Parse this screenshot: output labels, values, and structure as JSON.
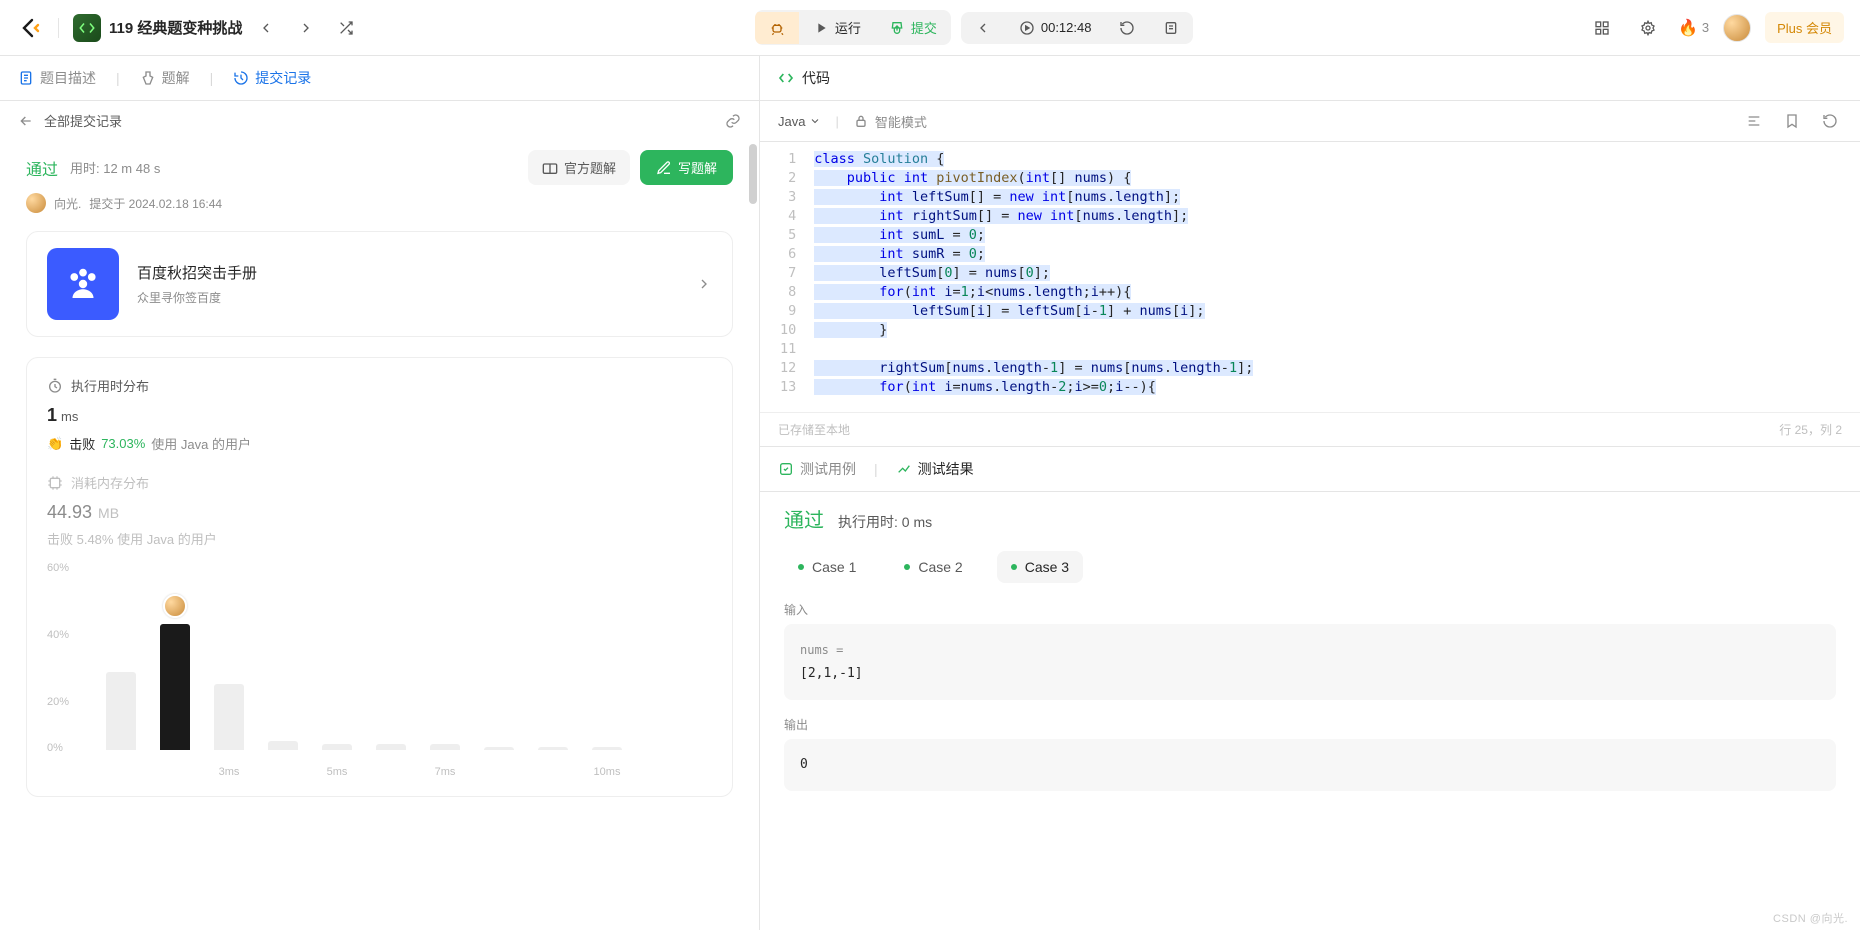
{
  "topbar": {
    "problem_id_badge": "⟨/⟩",
    "problem_title": "119 经典题变种挑战",
    "run_label": "运行",
    "submit_label": "提交",
    "timer": "00:12:48",
    "streak_count": "3",
    "plus_label": "Plus 会员"
  },
  "left": {
    "tabs": {
      "desc": "题目描述",
      "solution": "题解",
      "submissions": "提交记录"
    },
    "subhead": {
      "title": "全部提交记录"
    },
    "result": {
      "status": "通过",
      "time_used_label": "用时: 12 m 48 s",
      "author": "向光.",
      "submitted_at": "提交于 2024.02.18 16:44",
      "official_btn": "官方题解",
      "write_btn": "写题解"
    },
    "promo": {
      "title": "百度秋招突击手册",
      "sub": "众里寻你签百度"
    },
    "stats": {
      "exec_title": "执行用时分布",
      "exec_value": "1",
      "exec_unit": "ms",
      "beat_label": "击败",
      "beat_pct": "73.03%",
      "beat_suffix": "使用 Java 的用户",
      "mem_title": "消耗内存分布",
      "mem_value": "44.93",
      "mem_unit": "MB",
      "mem_beat": "击败 5.48% 使用 Java 的用户"
    },
    "chart_data": {
      "type": "bar",
      "y_ticks": [
        "60%",
        "40%",
        "20%",
        "0%"
      ],
      "x_ticks": [
        "",
        "",
        "3ms",
        "",
        "5ms",
        "",
        "7ms",
        "",
        "",
        "10ms"
      ],
      "bars_pct": [
        26,
        42,
        22,
        3,
        2,
        2,
        2,
        1,
        1,
        1
      ],
      "highlight_index": 1
    }
  },
  "right": {
    "code_header": "代码",
    "language": "Java",
    "mode_label": "智能模式",
    "status_left": "已存储至本地",
    "status_right": "行 25，列 2",
    "code_lines": [
      "class Solution {",
      "    public int pivotIndex(int[] nums) {",
      "        int leftSum[] = new int[nums.length];",
      "        int rightSum[] = new int[nums.length];",
      "        int sumL = 0;",
      "        int sumR = 0;",
      "        leftSum[0] = nums[0];",
      "        for(int i=1;i<nums.length;i++){",
      "            leftSum[i] = leftSum[i-1] + nums[i];",
      "        }",
      "",
      "        rightSum[nums.length-1] = nums[nums.length-1];",
      "        for(int i=nums.length-2;i>=0;i--){"
    ],
    "tests": {
      "cases_tab": "测试用例",
      "results_tab": "测试结果",
      "pass": "通过",
      "runtime_label": "执行用时: 0 ms",
      "case_labels": [
        "Case 1",
        "Case 2",
        "Case 3"
      ],
      "active_case": 2,
      "input_label": "输入",
      "input_var": "nums =",
      "input_val": "[2,1,-1]",
      "output_label": "输出",
      "output_val": "0"
    }
  },
  "watermark": "CSDN @向光."
}
